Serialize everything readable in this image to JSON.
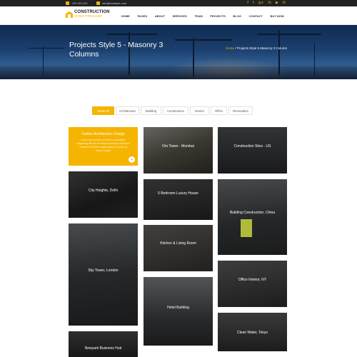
{
  "topbar": {
    "phone": "+00 123 123",
    "email": "info@example.com",
    "socials": [
      "f",
      "t",
      "g+",
      "in",
      "▶",
      "✉"
    ]
  },
  "logo": {
    "line1": "CONSTRUCTION",
    "line2": "ZONE PREMIUM"
  },
  "nav": [
    "HOME",
    "PAGES",
    "ABOUT",
    "SERVICES",
    "TEAM",
    "PROJECTS",
    "BLOG",
    "CONTACT",
    "BUY NOW"
  ],
  "hero": {
    "title": "Projects Style 5 - Masonry 3 Columns",
    "breadcrumb_home": "Home",
    "breadcrumb_sep": "/",
    "breadcrumb_current": "Projects Style 5 Masonry 3 Column"
  },
  "filters": [
    "Show All",
    "Architecture",
    "Building",
    "Construction",
    "Interior",
    "Office",
    "Renovation"
  ],
  "projects": {
    "featured": {
      "title": "Carline Architecture Design",
      "desc": "Lorem ipsum dolor sit amet, consectetur adipiscing elit sed do eiusmod tempor incididunt ut labore et dolore magna aliqua ut enim ad minim veniam"
    },
    "col1": [
      "City Heights, Delhi",
      "Sky Tower, London",
      "Newyark Business Hub"
    ],
    "col2": [
      "Om Tower - Mumbai",
      "5 Bedroom Luxury House",
      "Kitchen & Living Room",
      "Hotel Building"
    ],
    "col3": [
      "Construction Sites - US",
      "Building Construction, China",
      "Office Interior, NY",
      "Clean Water, Tokyo"
    ]
  },
  "colors": {
    "accent": "#f5b400",
    "dark": "#222222"
  }
}
